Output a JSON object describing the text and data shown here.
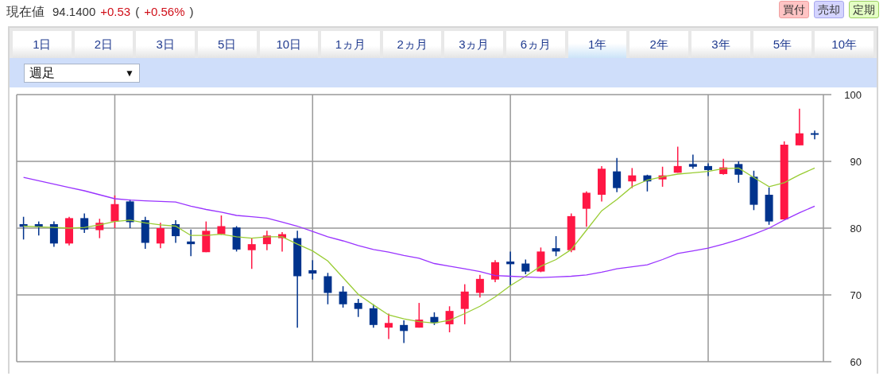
{
  "quote": {
    "label": "現在値",
    "price": "94.1400",
    "change": "+0.53",
    "open_paren": "(",
    "change_percent": "+0.56%",
    "close_paren": ")"
  },
  "actions": [
    {
      "label": "買付",
      "kind": "buy"
    },
    {
      "label": "売却",
      "kind": "sell"
    },
    {
      "label": "定期",
      "kind": "regular"
    }
  ],
  "tabs": [
    {
      "label": "1日",
      "selected": false
    },
    {
      "label": "2日",
      "selected": false
    },
    {
      "label": "3日",
      "selected": false
    },
    {
      "label": "5日",
      "selected": false
    },
    {
      "label": "10日",
      "selected": false
    },
    {
      "label": "1ヵ月",
      "selected": false
    },
    {
      "label": "2ヵ月",
      "selected": false
    },
    {
      "label": "3ヵ月",
      "selected": false
    },
    {
      "label": "6ヵ月",
      "selected": false
    },
    {
      "label": "1年",
      "selected": true
    },
    {
      "label": "2年",
      "selected": false
    },
    {
      "label": "3年",
      "selected": false
    },
    {
      "label": "5年",
      "selected": false
    },
    {
      "label": "10年",
      "selected": false
    }
  ],
  "interval_select": {
    "value": "週足",
    "arrow": "▼"
  },
  "chart": {
    "chart_data": {
      "type": "candlestick",
      "ylim": [
        60,
        100
      ],
      "yticks": [
        60,
        70,
        80,
        90,
        100
      ],
      "grid": true,
      "ohlc": [
        [
          80.6,
          81.7,
          78.3,
          80.2
        ],
        [
          80.6,
          81.0,
          78.9,
          80.2
        ],
        [
          80.6,
          81.0,
          77.2,
          77.7
        ],
        [
          77.7,
          81.7,
          77.4,
          81.5
        ],
        [
          81.5,
          82.2,
          79.3,
          79.8
        ],
        [
          79.7,
          81.4,
          78.5,
          80.8
        ],
        [
          81.0,
          84.9,
          80.0,
          83.6
        ],
        [
          84.0,
          84.3,
          80.0,
          80.9
        ],
        [
          81.2,
          81.7,
          76.9,
          77.8
        ],
        [
          77.7,
          80.8,
          77.0,
          80.0
        ],
        [
          80.6,
          81.2,
          77.8,
          78.8
        ],
        [
          78.0,
          79.8,
          75.8,
          77.6
        ],
        [
          76.4,
          81.0,
          76.4,
          79.6
        ],
        [
          79.1,
          81.9,
          79.0,
          80.3
        ],
        [
          80.1,
          80.3,
          76.5,
          76.8
        ],
        [
          76.7,
          78.5,
          73.9,
          77.6
        ],
        [
          77.6,
          79.6,
          76.7,
          78.9
        ],
        [
          78.5,
          79.4,
          76.5,
          79.1
        ],
        [
          78.5,
          79.6,
          65.1,
          72.8
        ],
        [
          73.7,
          75.2,
          72.3,
          73.2
        ],
        [
          72.8,
          73.3,
          68.6,
          70.3
        ],
        [
          70.5,
          71.3,
          68.1,
          68.6
        ],
        [
          68.8,
          69.4,
          66.7,
          67.9
        ],
        [
          68.0,
          68.6,
          65.1,
          65.5
        ],
        [
          65.1,
          67.2,
          63.4,
          65.8
        ],
        [
          65.5,
          66.2,
          62.8,
          64.6
        ],
        [
          65.1,
          68.8,
          65.1,
          66.3
        ],
        [
          66.7,
          67.4,
          65.5,
          65.8
        ],
        [
          65.6,
          68.3,
          64.4,
          67.6
        ],
        [
          67.9,
          71.6,
          65.6,
          70.5
        ],
        [
          70.3,
          73.0,
          69.6,
          72.4
        ],
        [
          72.3,
          75.2,
          71.9,
          74.9
        ],
        [
          75.0,
          76.5,
          71.4,
          74.6
        ],
        [
          74.7,
          75.3,
          73.1,
          73.5
        ],
        [
          73.5,
          77.1,
          73.4,
          76.5
        ],
        [
          77.0,
          78.8,
          75.8,
          76.5
        ],
        [
          76.7,
          82.2,
          76.4,
          81.8
        ],
        [
          82.9,
          85.5,
          80.2,
          85.3
        ],
        [
          85.0,
          89.3,
          84.0,
          88.9
        ],
        [
          88.5,
          90.5,
          85.4,
          86.0
        ],
        [
          87.0,
          89.0,
          86.0,
          87.9
        ],
        [
          87.9,
          88.0,
          85.5,
          87.0
        ],
        [
          87.3,
          89.2,
          86.2,
          87.9
        ],
        [
          88.3,
          92.2,
          88.3,
          89.3
        ],
        [
          89.6,
          91.0,
          88.9,
          89.2
        ],
        [
          89.3,
          89.7,
          87.8,
          88.7
        ],
        [
          88.1,
          90.4,
          88.0,
          89.1
        ],
        [
          89.6,
          90.0,
          86.8,
          88.0
        ],
        [
          87.7,
          88.6,
          82.7,
          83.5
        ],
        [
          85.0,
          86.1,
          80.5,
          81.0
        ],
        [
          81.3,
          93.0,
          81.3,
          92.5
        ],
        [
          92.4,
          97.9,
          92.4,
          94.2
        ],
        [
          94.1,
          94.6,
          93.3,
          94.1
        ]
      ]
    }
  },
  "moving_averages": {
    "chart_data": {
      "type": "line",
      "ylim": [
        60,
        100
      ],
      "series": [
        {
          "color": "#99cc33",
          "values": [
            80.3,
            80.2,
            80.1,
            80.0,
            80.1,
            80.5,
            81.0,
            81.2,
            80.8,
            80.5,
            80.3,
            78.9,
            78.9,
            79.1,
            78.7,
            78.5,
            78.7,
            78.7,
            77.6,
            76.6,
            75.1,
            72.6,
            70.1,
            68.5,
            67.0,
            66.4,
            66.0,
            65.8,
            66.2,
            67.2,
            68.3,
            69.7,
            71.4,
            72.8,
            74.3,
            75.3,
            76.8,
            79.7,
            82.6,
            84.3,
            86.2,
            87.2,
            87.7,
            88.1,
            88.3,
            88.5,
            88.9,
            89.0,
            87.6,
            86.2,
            86.8,
            88.0,
            89.0
          ]
        },
        {
          "color": "#9933ff",
          "values": [
            87.6,
            87.1,
            86.6,
            86.1,
            85.6,
            85.0,
            84.4,
            84.2,
            84.1,
            84.0,
            83.9,
            83.3,
            82.8,
            82.4,
            81.9,
            81.7,
            81.5,
            80.9,
            80.3,
            79.5,
            78.7,
            78.1,
            77.4,
            76.8,
            76.4,
            75.9,
            75.5,
            74.7,
            74.3,
            73.9,
            73.5,
            72.9,
            72.8,
            72.7,
            72.6,
            72.7,
            72.8,
            73.0,
            73.4,
            73.9,
            74.2,
            74.5,
            75.3,
            76.2,
            76.6,
            77.0,
            77.6,
            78.3,
            79.1,
            80.0,
            81.2,
            82.3,
            83.3
          ]
        }
      ]
    }
  }
}
